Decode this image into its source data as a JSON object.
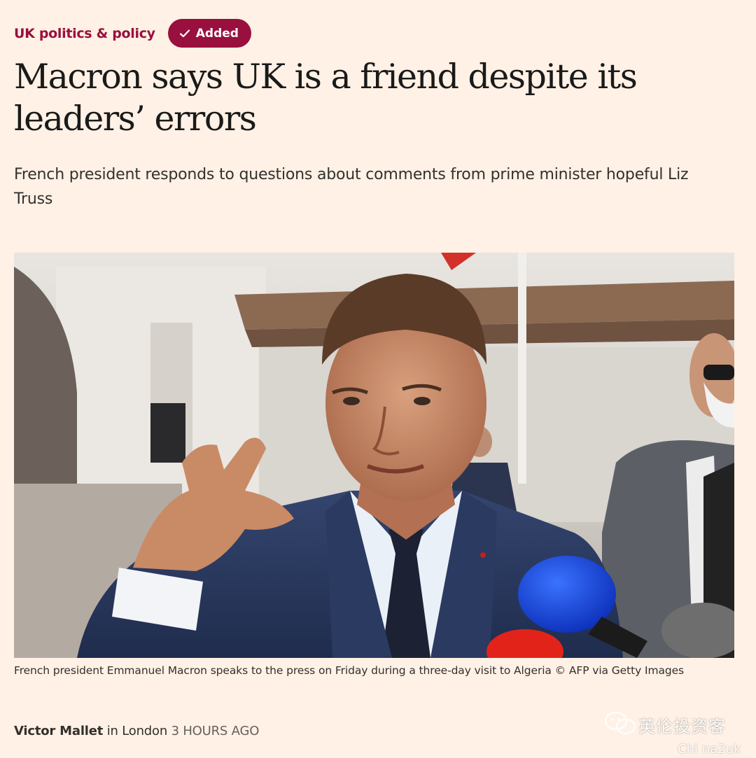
{
  "article": {
    "topic": "UK politics & policy",
    "follow_button": {
      "label": "Added",
      "icon": "check-icon"
    },
    "headline": "Macron says UK is a friend despite its leaders’ errors",
    "standfirst": "French president responds to questions about comments from prime minister hopeful Liz Truss",
    "image": {
      "caption": "French president Emmanuel Macron speaks to the press on Friday during a three-day visit to Algeria © AFP via Getty Images"
    },
    "byline": {
      "author": "Victor Mallet",
      "location_prefix": "in London",
      "timestamp": "3 HOURS AGO"
    }
  },
  "watermark": {
    "text": "英伦投资客",
    "subtext": "Chi na2uk"
  },
  "colors": {
    "background": "#fff1e5",
    "accent": "#990f3d",
    "text": "#33302e"
  }
}
